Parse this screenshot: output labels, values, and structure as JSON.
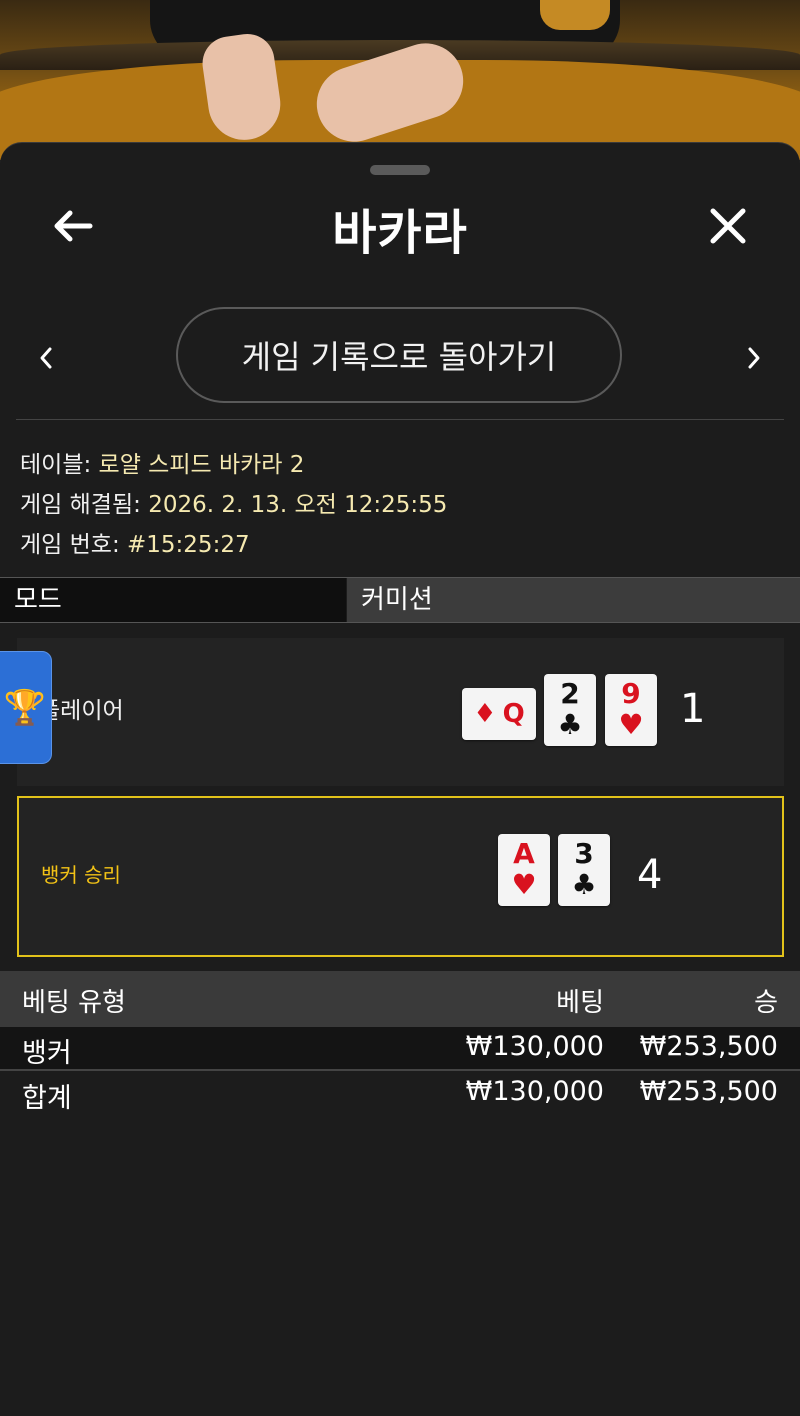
{
  "header": {
    "title": "바카라",
    "back_icon": "arrow-left-icon",
    "close_icon": "close-icon"
  },
  "nav": {
    "return_label": "게임 기록으로 돌아가기",
    "prev_icon": "chevron-left-icon",
    "next_icon": "chevron-right-icon"
  },
  "info": {
    "table_label": "테이블:",
    "table_value": "로얄 스피드 바카라 2",
    "resolved_label": "게임 해결됨:",
    "resolved_value": "2026. 2. 13. 오전 12:25:55",
    "number_label": "게임 번호:",
    "number_value": "#15:25:27"
  },
  "mode": {
    "label": "모드",
    "value": "커미션"
  },
  "player": {
    "label": "플레이어",
    "score": "1",
    "cards": [
      {
        "rank": "Q",
        "suit": "♦",
        "color": "red",
        "orientation": "sideways"
      },
      {
        "rank": "2",
        "suit": "♣",
        "color": "black"
      },
      {
        "rank": "9",
        "suit": "♥",
        "color": "red"
      }
    ]
  },
  "banker": {
    "label": "뱅커 승리",
    "score": "4",
    "cards": [
      {
        "rank": "A",
        "suit": "♥",
        "color": "red"
      },
      {
        "rank": "3",
        "suit": "♣",
        "color": "black"
      }
    ],
    "highlight_color": "#e2c21a"
  },
  "trophy": {
    "icon": "🏆"
  },
  "bets": {
    "headers": {
      "type": "베팅 유형",
      "bet": "베팅",
      "win": "승"
    },
    "rows": [
      {
        "type": "뱅커",
        "bet": "₩130,000",
        "win": "₩253,500"
      },
      {
        "type": "합계",
        "bet": "₩130,000",
        "win": "₩253,500"
      }
    ]
  }
}
